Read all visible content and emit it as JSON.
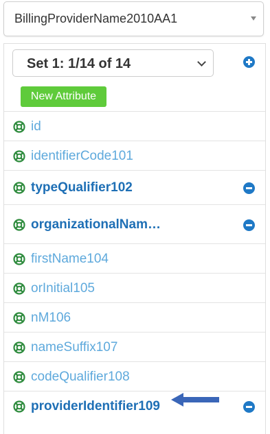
{
  "top_select": {
    "value": "BillingProviderName2010AA1"
  },
  "set_select": {
    "value": "Set 1: 1/14 of 14"
  },
  "new_attribute_label": "New Attribute",
  "attributes": [
    {
      "label": "id",
      "bold": false,
      "removable": false
    },
    {
      "label": "identifierCode101",
      "bold": false,
      "removable": false
    },
    {
      "label": "typeQualifier102",
      "bold": true,
      "removable": true
    },
    {
      "label": "organizationalNam…",
      "bold": true,
      "removable": true
    },
    {
      "label": "firstName104",
      "bold": false,
      "removable": false
    },
    {
      "label": "orInitial105",
      "bold": false,
      "removable": false
    },
    {
      "label": "nM106",
      "bold": false,
      "removable": false
    },
    {
      "label": "nameSuffix107",
      "bold": false,
      "removable": false
    },
    {
      "label": "codeQualifier108",
      "bold": false,
      "removable": false
    },
    {
      "label": "providerIdentifier109",
      "bold": true,
      "removable": true
    }
  ],
  "colors": {
    "link": "#5ea9dc",
    "link_bold": "#1e6fb5",
    "accent_button": "#1f79c6",
    "new_button": "#5fcb3b",
    "icon_green": "#2e8b3d",
    "arrow": "#3a66b8"
  },
  "icons": {
    "attribute_icon": "lifebuoy-icon",
    "add_icon": "plus-circle-icon",
    "remove_icon": "minus-circle-icon",
    "pointer_arrow": "left-arrow-icon"
  }
}
